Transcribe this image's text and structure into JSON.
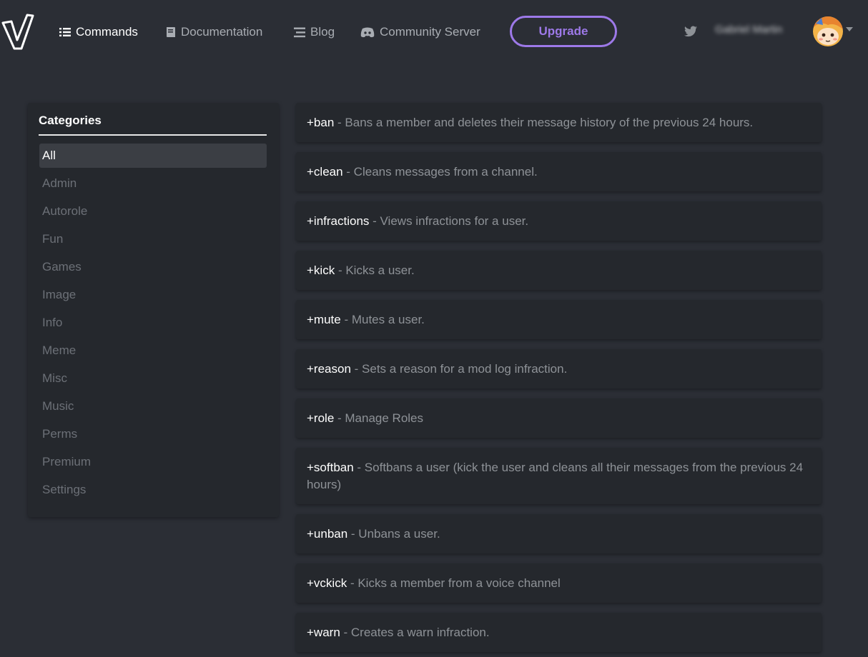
{
  "nav": {
    "logo_icon": "vainglory-v-logo",
    "links": [
      {
        "label": "Commands",
        "icon": "list-icon"
      },
      {
        "label": "Documentation",
        "icon": "book-icon"
      },
      {
        "label": "Blog",
        "icon": "lines-icon"
      },
      {
        "label": "Community Server",
        "icon": "discord-icon"
      }
    ],
    "upgrade_label": "Upgrade",
    "username": "Gabriel Martin",
    "accent_color": "#9d79e8"
  },
  "sidebar": {
    "title": "Categories",
    "categories": [
      {
        "label": "All",
        "active": true
      },
      {
        "label": "Admin"
      },
      {
        "label": "Autorole"
      },
      {
        "label": "Fun"
      },
      {
        "label": "Games"
      },
      {
        "label": "Image"
      },
      {
        "label": "Info"
      },
      {
        "label": "Meme"
      },
      {
        "label": "Misc"
      },
      {
        "label": "Music"
      },
      {
        "label": "Perms"
      },
      {
        "label": "Premium"
      },
      {
        "label": "Settings"
      }
    ]
  },
  "commands": [
    {
      "name": "+ban",
      "desc": " - Bans a member and deletes their message history of the previous 24 hours."
    },
    {
      "name": "+clean",
      "desc": " - Cleans messages from a channel."
    },
    {
      "name": "+infractions",
      "desc": " - Views infractions for a user."
    },
    {
      "name": "+kick",
      "desc": " - Kicks a user."
    },
    {
      "name": "+mute",
      "desc": " - Mutes a user."
    },
    {
      "name": "+reason",
      "desc": " - Sets a reason for a mod log infraction."
    },
    {
      "name": "+role",
      "desc": " - Manage Roles"
    },
    {
      "name": "+softban",
      "desc": " - Softbans a user (kick the user and cleans all their messages from the previous 24 hours)"
    },
    {
      "name": "+unban",
      "desc": " - Unbans a user."
    },
    {
      "name": "+vckick",
      "desc": " - Kicks a member from a voice channel"
    },
    {
      "name": "+warn",
      "desc": " - Creates a warn infraction."
    }
  ]
}
